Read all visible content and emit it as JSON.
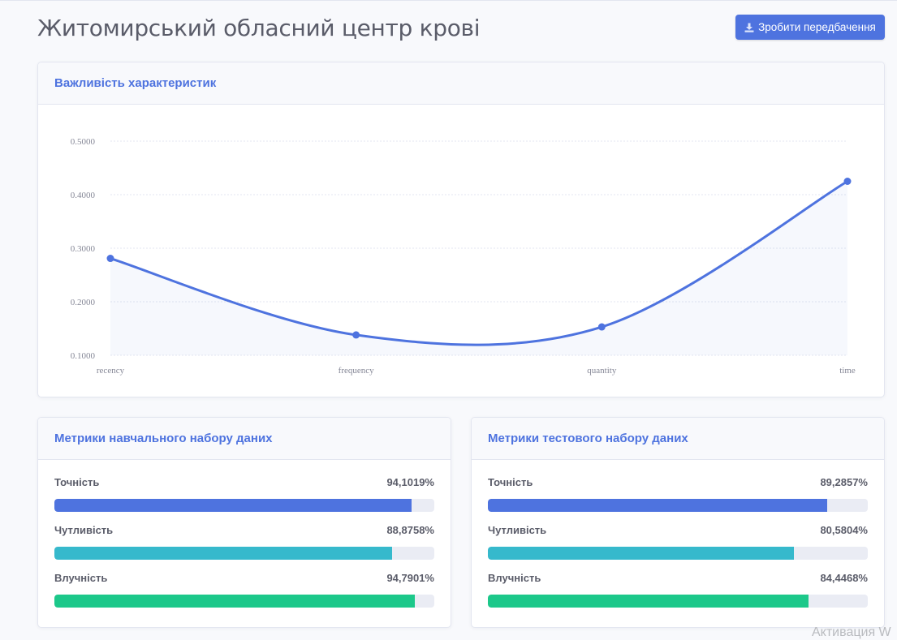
{
  "page": {
    "title": "Житомирський обласний центр крові",
    "predict_button": "Зробити передбачення"
  },
  "importance_card": {
    "title": "Важливість характеристик"
  },
  "chart_data": {
    "type": "area",
    "categories": [
      "recency",
      "frequency",
      "quantity",
      "time"
    ],
    "series": [
      {
        "values": [
          0.281,
          0.138,
          0.153,
          0.425
        ]
      }
    ],
    "yticks": [
      "0.1000",
      "0.2000",
      "0.3000",
      "0.4000",
      "0.5000"
    ],
    "ylim": [
      0.1,
      0.5
    ],
    "grid": true,
    "colors": {
      "line": "#4e73df",
      "fill": "rgba(78,115,223,0.05)"
    }
  },
  "train_metrics": {
    "title": "Метрики навчального набору даних",
    "items": [
      {
        "label": "Точність",
        "value": "94,1019%",
        "percent": 94.1019,
        "color": "#4e73df"
      },
      {
        "label": "Чутливість",
        "value": "88,8758%",
        "percent": 88.8758,
        "color": "#36b9cc"
      },
      {
        "label": "Влучність",
        "value": "94,7901%",
        "percent": 94.7901,
        "color": "#1cc88a"
      }
    ]
  },
  "test_metrics": {
    "title": "Метрики тестового набору даних",
    "items": [
      {
        "label": "Точність",
        "value": "89,2857%",
        "percent": 89.2857,
        "color": "#4e73df"
      },
      {
        "label": "Чутливість",
        "value": "80,5804%",
        "percent": 80.5804,
        "color": "#36b9cc"
      },
      {
        "label": "Влучність",
        "value": "84,4468%",
        "percent": 84.4468,
        "color": "#1cc88a"
      }
    ]
  },
  "watermark": "Активация W",
  "icons": {
    "predict_button": "download-icon"
  }
}
